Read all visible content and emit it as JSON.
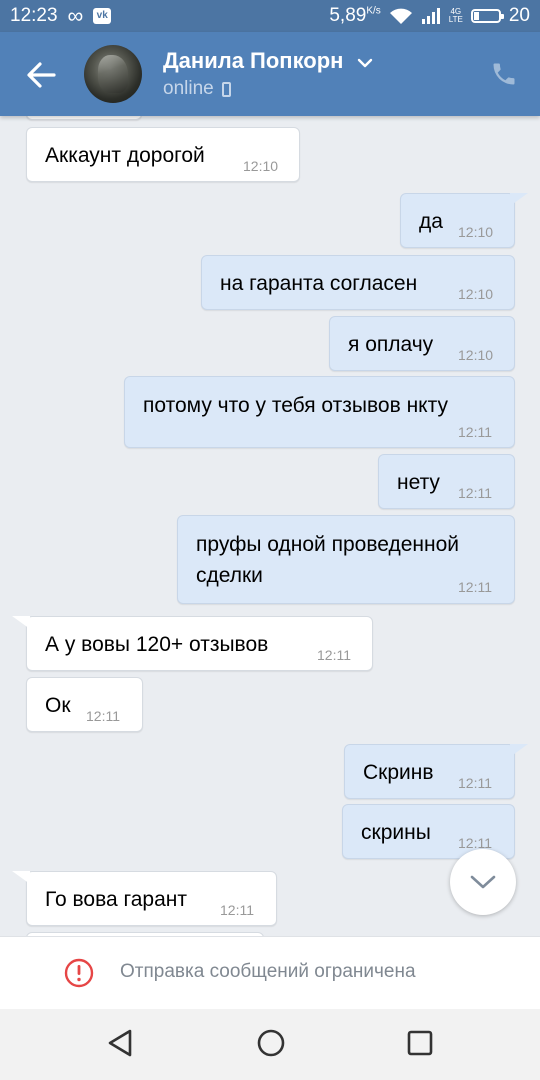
{
  "status_bar": {
    "time": "12:23",
    "infinity": "∞",
    "vk_badge": "vk",
    "net_speed": "5,89",
    "net_unit": "K/s",
    "network_top": "4G",
    "network_bottom": "LTE",
    "battery": "20"
  },
  "header": {
    "contact_name": "Данила Попкорн",
    "status": "online",
    "icons": [
      "back-arrow-icon",
      "chevron-down-icon",
      "mobile-phone-icon",
      "call-icon"
    ]
  },
  "messages": [
    {
      "dir": "in",
      "text": "Аккаунт дорогой",
      "time": "12:10"
    },
    {
      "dir": "out",
      "text": "да",
      "time": "12:10"
    },
    {
      "dir": "out",
      "text": "на гаранта согласен",
      "time": "12:10"
    },
    {
      "dir": "out",
      "text": "я оплачу",
      "time": "12:10"
    },
    {
      "dir": "out",
      "text": "потому что у тебя отзывов нкту",
      "time": "12:11"
    },
    {
      "dir": "out",
      "text": "нету",
      "time": "12:11"
    },
    {
      "dir": "out",
      "text_line1": "пруфы одной проведенной",
      "text_line2": "сделки",
      "time": "12:11"
    },
    {
      "dir": "in",
      "text": "А у вовы 120+ отзывов",
      "time": "12:11"
    },
    {
      "dir": "in",
      "text": "Ок",
      "time": "12:11"
    },
    {
      "dir": "out",
      "text": "Скринв",
      "time": "12:11"
    },
    {
      "dir": "out",
      "text": "скрины",
      "time": "12:11"
    },
    {
      "dir": "in",
      "text": "Го вова гарант",
      "time": "12:11"
    }
  ],
  "restricted_banner": {
    "text": "Отправка сообщений ограничена",
    "icon": "warning-circle-icon",
    "accent": "#e64646"
  },
  "colors": {
    "header": "#5181b8",
    "status_bar": "#4c75a3",
    "background": "#eaedf1",
    "bubble_out": "#dbe8f8",
    "bubble_in": "#ffffff"
  }
}
